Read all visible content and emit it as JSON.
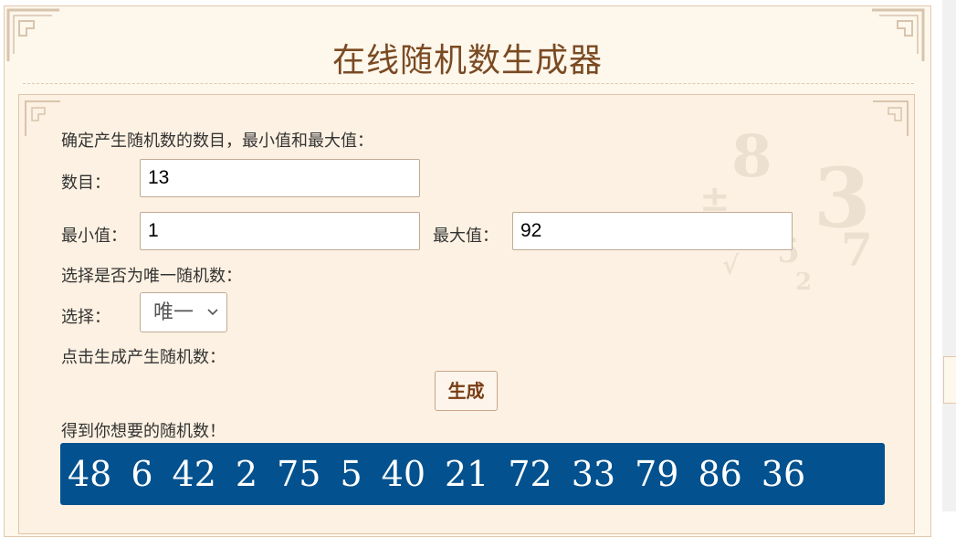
{
  "page": {
    "title": "在线随机数生成器"
  },
  "form": {
    "intro": "确定产生随机数的数目，最小值和最大值：",
    "count_label": "数目：",
    "count_value": "13",
    "min_label": "最小值：",
    "min_value": "1",
    "max_label": "最大值：",
    "max_value": "92",
    "unique_prompt": "选择是否为唯一随机数：",
    "select_label": "选择：",
    "select_value": "唯一",
    "generate_prompt": "点击生成产生随机数：",
    "generate_button": "生成",
    "result_label": "得到你想要的随机数！"
  },
  "results": [
    "48",
    "6",
    "42",
    "2",
    "75",
    "5",
    "40",
    "21",
    "72",
    "33",
    "79",
    "86",
    "36"
  ],
  "colors": {
    "title": "#7a4a22",
    "result_bg": "#03528f",
    "panel_bg": "#fdf7ec",
    "button_text": "#7a3c14"
  },
  "icons": {
    "select_arrow": "chevron-down-icon",
    "corner": "corner-ornament-icon"
  }
}
